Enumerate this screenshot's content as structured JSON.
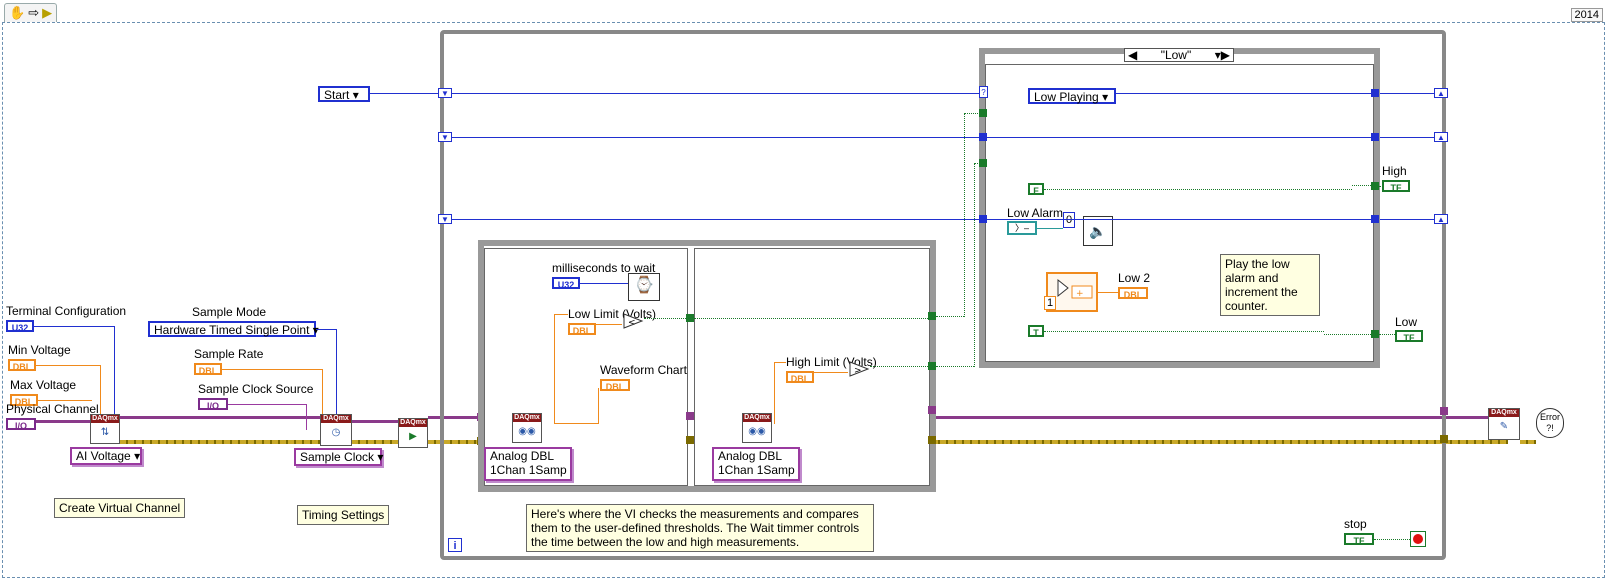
{
  "toolbar": {
    "icons": [
      "hand-icon",
      "arrow-icon",
      "run-icon"
    ],
    "year": "2014"
  },
  "labels": {
    "terminal_configuration": "Terminal Configuration",
    "min_voltage": "Min Voltage",
    "max_voltage": "Max Voltage",
    "physical_channel": "Physical Channel",
    "sample_mode": "Sample Mode",
    "sample_rate": "Sample Rate",
    "sample_clock_source": "Sample Clock Source",
    "milliseconds_to_wait": "milliseconds to wait",
    "low_limit": "Low Limit (Volts)",
    "high_limit": "High Limit (Volts)",
    "waveform_chart": "Waveform Chart",
    "low_alarm": "Low Alarm",
    "low2": "Low 2",
    "high": "High",
    "low": "Low",
    "stop": "stop"
  },
  "terminals": {
    "u32": "U32",
    "dbl": "DBL",
    "io": "I/O",
    "tf": "TF",
    "f": "F",
    "t": "T",
    "zero": "0",
    "one": "1"
  },
  "controls": {
    "start_enum": "Start",
    "sample_mode_value": "Hardware Timed Single Point",
    "ai_voltage": "AI Voltage",
    "sample_clock": "Sample Clock",
    "read_poly_1_line1": "Analog DBL",
    "read_poly_1_line2": "1Chan 1Samp",
    "read_poly_2_line1": "Analog DBL",
    "read_poly_2_line2": "1Chan 1Samp",
    "case_selector": "\"Low\"",
    "low_playing": "Low Playing"
  },
  "daqmx_header": "DAQmx",
  "notes": {
    "create_virtual_channel": "Create Virtual Channel",
    "timing_settings": "Timing Settings",
    "measurement_comment": "Here's where the VI checks the measurements and compares them to the user-defined thresholds. The Wait timmer controls the time between the low and high measurements.",
    "play_low_alarm": "Play the low alarm and increment the counter."
  },
  "iteration": "i",
  "error_icon_text": "Error ?!",
  "colors": {
    "error_wire": "#c9a928",
    "task_wire": "#8a3a8a",
    "enum_wire": "#2030d0",
    "bool_wire": "#1a7a2a",
    "dbl_wire": "#f08a1c"
  }
}
